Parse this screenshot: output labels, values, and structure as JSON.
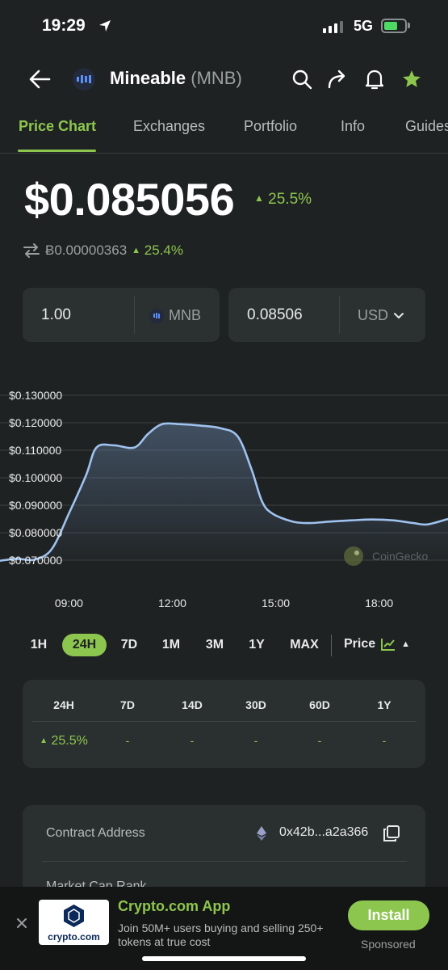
{
  "status": {
    "time": "19:29",
    "network": "5G"
  },
  "header": {
    "coin_name": "Mineable",
    "coin_symbol": "(MNB)"
  },
  "tabs": [
    {
      "label": "Price Chart",
      "active": true
    },
    {
      "label": "Exchanges"
    },
    {
      "label": "Portfolio"
    },
    {
      "label": "Info"
    },
    {
      "label": "Guides"
    }
  ],
  "price": {
    "value": "$0.085056",
    "change": "25.5%",
    "btc_value": "Ƀ0.00000363",
    "btc_change": "25.4%"
  },
  "converter": {
    "amount": "1.00",
    "amount_unit": "MNB",
    "converted": "0.08506",
    "currency": "USD"
  },
  "chart_data": {
    "type": "line",
    "y_ticks": [
      "$0.130000",
      "$0.120000",
      "$0.110000",
      "$0.100000",
      "$0.090000",
      "$0.080000",
      "$0.070000"
    ],
    "x_ticks": [
      "09:00",
      "12:00",
      "15:00",
      "18:00"
    ],
    "ylim": [
      0.07,
      0.13
    ],
    "xlim": [
      7.0,
      20.0
    ],
    "watermark": "CoinGecko",
    "series": [
      {
        "x": [
          7.0,
          7.5,
          8.0,
          8.5,
          9.0,
          9.5,
          9.8,
          10.3,
          10.9,
          11.3,
          11.7,
          12.2,
          12.8,
          13.4,
          13.9,
          14.3,
          14.6,
          14.9,
          15.5,
          16.0,
          16.5,
          17.2,
          17.8,
          18.4,
          19.0,
          19.4,
          20.0
        ],
        "y": [
          0.0698,
          0.0705,
          0.0702,
          0.074,
          0.087,
          0.101,
          0.111,
          0.1118,
          0.111,
          0.116,
          0.1195,
          0.1195,
          0.119,
          0.118,
          0.115,
          0.103,
          0.0915,
          0.087,
          0.084,
          0.0835,
          0.084,
          0.0845,
          0.0848,
          0.0845,
          0.0835,
          0.083,
          0.085
        ]
      }
    ]
  },
  "ranges": [
    {
      "label": "1H"
    },
    {
      "label": "24H",
      "active": true
    },
    {
      "label": "7D"
    },
    {
      "label": "1M"
    },
    {
      "label": "3M"
    },
    {
      "label": "1Y"
    },
    {
      "label": "MAX"
    }
  ],
  "price_toggle": "Price",
  "performance": {
    "headers": [
      "24H",
      "7D",
      "14D",
      "30D",
      "60D",
      "1Y"
    ],
    "values": [
      "25.5%",
      "-",
      "-",
      "-",
      "-",
      "-"
    ]
  },
  "info": {
    "contract_label": "Contract Address",
    "contract_value": "0x42b...a2a366",
    "next_label": "Market Cap Rank"
  },
  "ad": {
    "logo_text": "crypto.com",
    "title": "Crypto.com App",
    "description": "Join 50M+ users buying and selling 250+ tokens at true cost",
    "button": "Install",
    "sponsored": "Sponsored"
  },
  "colors": {
    "accent": "#8dc64f",
    "background": "#1f2223",
    "line": "#9fc2ee"
  }
}
